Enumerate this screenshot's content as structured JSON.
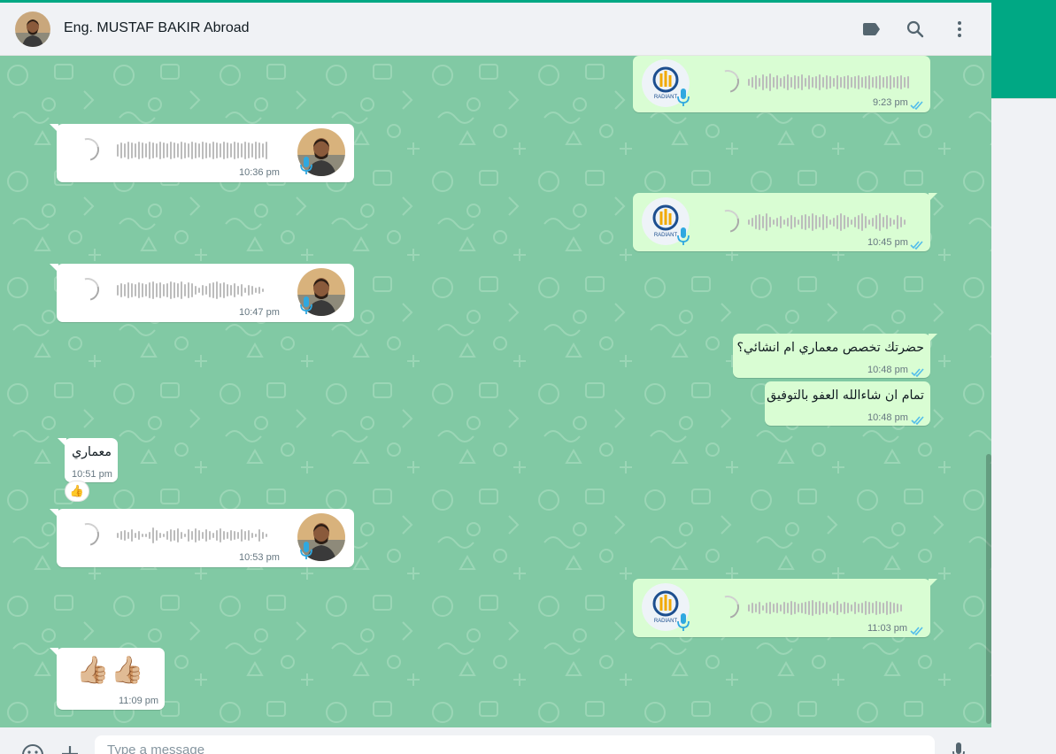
{
  "contact": {
    "name": "Eng. MUSTAF BAKIR Abroad",
    "avatar_icon": "contact-photo"
  },
  "header_actions": [
    {
      "name": "label-icon"
    },
    {
      "name": "search-icon"
    },
    {
      "name": "menu-icon"
    }
  ],
  "colors": {
    "accent": "#00a884",
    "chat_background": "#81c9a4",
    "outgoing_bubble": "#d9fdd3",
    "incoming_bubble": "#ffffff",
    "read_ticks": "#53bdeb",
    "mic_incoming": "#2fa8e0",
    "mic_outgoing": "#2fa8e0"
  },
  "messages": [
    {
      "type": "voice",
      "direction": "out",
      "time": "9:23 pm",
      "status": "read"
    },
    {
      "type": "voice",
      "direction": "in",
      "time": "10:36 pm"
    },
    {
      "type": "voice",
      "direction": "out",
      "time": "10:45 pm",
      "status": "read"
    },
    {
      "type": "voice",
      "direction": "in",
      "time": "10:47 pm"
    },
    {
      "type": "text",
      "direction": "out",
      "text": "حضرتك تخصص معماري ام انشائي؟",
      "time": "10:48 pm",
      "status": "read"
    },
    {
      "type": "text",
      "direction": "out",
      "text": "تمام ان شاءالله العفو بالتوفيق",
      "time": "10:48 pm",
      "status": "read"
    },
    {
      "type": "text",
      "direction": "in",
      "text": "معماري",
      "time": "10:51 pm",
      "reaction": "👍"
    },
    {
      "type": "voice",
      "direction": "in",
      "time": "10:53 pm"
    },
    {
      "type": "voice",
      "direction": "out",
      "time": "11:03 pm",
      "status": "read"
    },
    {
      "type": "emoji",
      "direction": "in",
      "text": "👍🏼👍🏼",
      "time": "11:09 pm"
    }
  ],
  "composer": {
    "placeholder": "Type a message",
    "emoji_icon": "emoji-icon",
    "attach_icon": "attach-icon",
    "mic_icon": "microphone-icon"
  }
}
